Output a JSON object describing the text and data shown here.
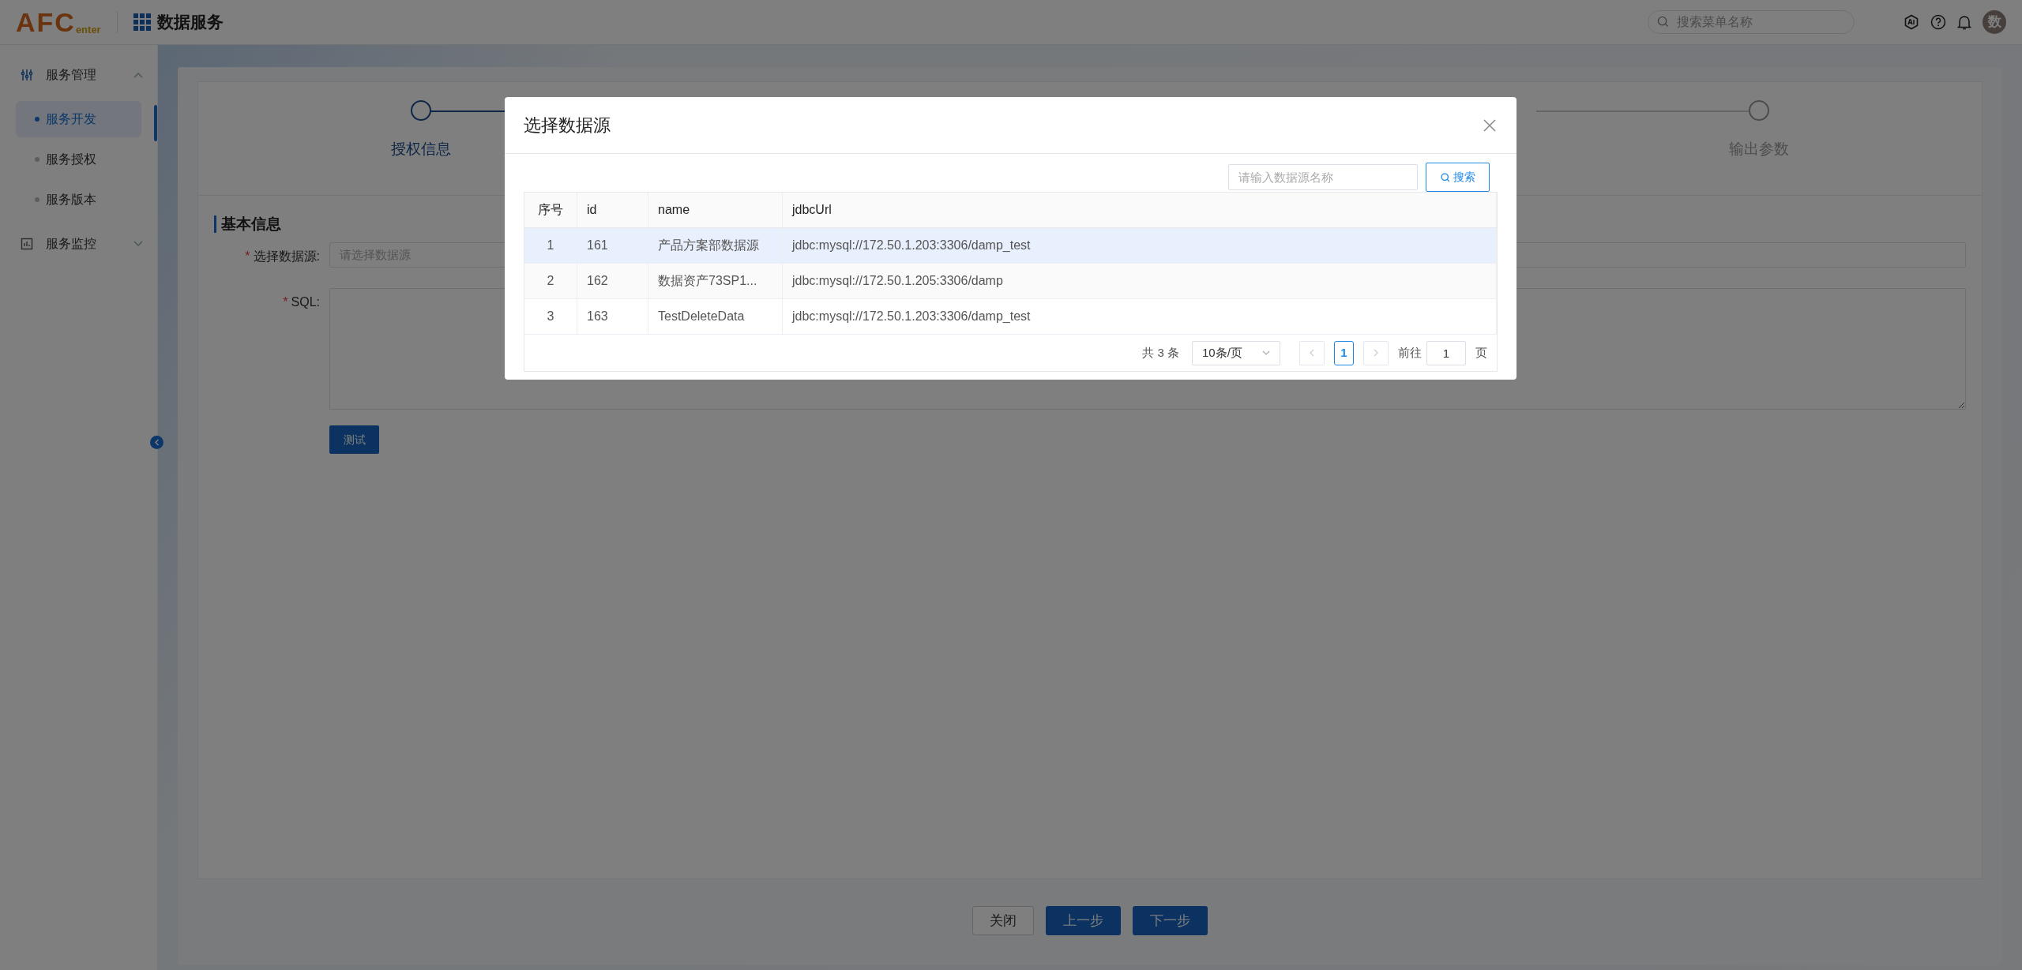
{
  "header": {
    "logo_main": "AFC",
    "logo_sub": "enter",
    "app_title": "数据服务",
    "search": {
      "placeholder": "搜索菜单名称"
    },
    "avatar": "数"
  },
  "sidebar": {
    "items": [
      {
        "label": "服务管理",
        "expanded": true,
        "children": [
          {
            "label": "服务开发",
            "selected": true
          },
          {
            "label": "服务授权",
            "selected": false
          },
          {
            "label": "服务版本",
            "selected": false
          }
        ]
      },
      {
        "label": "服务监控",
        "expanded": false
      }
    ]
  },
  "steps": [
    {
      "label": "授权信息",
      "active": true
    },
    {
      "label": "输出参数",
      "active": false
    }
  ],
  "form": {
    "section_title": "基本信息",
    "fields": [
      {
        "label": "选择数据源:",
        "required_mark": "*",
        "kind": "input",
        "placeholder": "请选择数据源"
      },
      {
        "label": "SQL:",
        "required_mark": "*",
        "kind": "textarea"
      }
    ],
    "test_button": "测试"
  },
  "footer_buttons": [
    {
      "label": "关闭",
      "kind": "default"
    },
    {
      "label": "上一步",
      "kind": "primary"
    },
    {
      "label": "下一步",
      "kind": "primary"
    }
  ],
  "dialog": {
    "title": "选择数据源",
    "search": {
      "placeholder": "请输入数据源名称"
    },
    "search_button": "搜索",
    "table": {
      "columns": [
        "序号",
        "id",
        "name",
        "jdbcUrl"
      ],
      "rows": [
        {
          "cells": [
            "1",
            "161",
            "产品方案部数据源",
            "jdbc:mysql://172.50.1.203:3306/damp_test"
          ],
          "selected": true
        },
        {
          "cells": [
            "2",
            "162",
            "数据资产73SP1...",
            "jdbc:mysql://172.50.1.205:3306/damp"
          ],
          "selected": false
        },
        {
          "cells": [
            "3",
            "163",
            "TestDeleteData",
            "jdbc:mysql://172.50.1.203:3306/damp_test"
          ],
          "selected": false
        }
      ]
    },
    "pagination": {
      "total": "共 3 条",
      "page_size": "10条/页",
      "pages": [
        {
          "label": "1",
          "selected": true
        }
      ],
      "goto_label": "前往",
      "goto_value": "1",
      "goto_suffix": "页"
    }
  }
}
